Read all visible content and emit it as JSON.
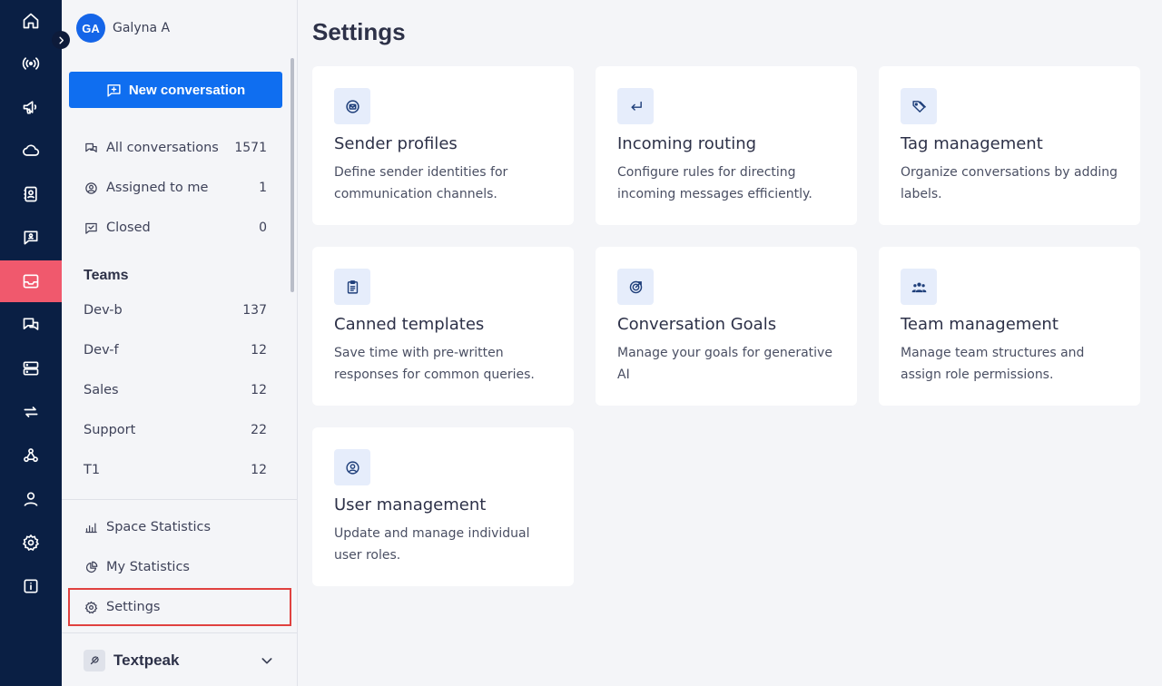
{
  "user": {
    "initials": "GA",
    "name": "Galyna A"
  },
  "new_conversation_label": "New conversation",
  "inbox": [
    {
      "label": "All conversations",
      "count": "1571",
      "icon": "chat-bubbles-icon"
    },
    {
      "label": "Assigned to me",
      "count": "1",
      "icon": "user-circle-icon"
    },
    {
      "label": "Closed",
      "count": "0",
      "icon": "closed-check-icon"
    }
  ],
  "teams_title": "Teams",
  "teams": [
    {
      "label": "Dev-b",
      "count": "137"
    },
    {
      "label": "Dev-f",
      "count": "12"
    },
    {
      "label": "Sales",
      "count": "12"
    },
    {
      "label": "Support",
      "count": "22"
    },
    {
      "label": "T1",
      "count": "12"
    }
  ],
  "bottom_nav": [
    {
      "label": "Space Statistics",
      "icon": "bar-chart-icon"
    },
    {
      "label": "My Statistics",
      "icon": "pie-chart-icon"
    },
    {
      "label": "Settings",
      "icon": "gear-icon"
    }
  ],
  "workspace": {
    "name": "Textpeak"
  },
  "page_title": "Settings",
  "cards": [
    {
      "title": "Sender profiles",
      "desc": "Define sender identities for communication channels.",
      "icon": "envelope-circle-icon"
    },
    {
      "title": "Incoming routing",
      "desc": "Configure rules for directing incoming messages efficiently.",
      "icon": "return-arrow-icon"
    },
    {
      "title": "Tag management",
      "desc": "Organize conversations by adding labels.",
      "icon": "tags-icon"
    },
    {
      "title": "Canned templates",
      "desc": "Save time with pre-written responses for common queries.",
      "icon": "clipboard-icon"
    },
    {
      "title": "Conversation Goals",
      "desc": "Manage your goals for generative AI",
      "icon": "target-icon"
    },
    {
      "title": "Team management",
      "desc": "Manage team structures and assign role permissions.",
      "icon": "team-icon"
    },
    {
      "title": "User management",
      "desc": "Update and manage individual user roles.",
      "icon": "user-circle-icon"
    }
  ],
  "rail_icons": [
    "home-icon",
    "broadcast-icon",
    "megaphone-icon",
    "cloud-icon",
    "contacts-icon",
    "chat-support-icon",
    "inbox-icon",
    "conversations-icon",
    "servers-icon",
    "sync-icon",
    "webhook-icon",
    "user-icon",
    "gear-icon",
    "info-icon"
  ],
  "colors": {
    "rail": "#0a1f44",
    "rail_active": "#f0596d",
    "primary": "#0f6ef0",
    "highlight": "#e0413f",
    "card_icon_bg": "#e6edfb"
  }
}
